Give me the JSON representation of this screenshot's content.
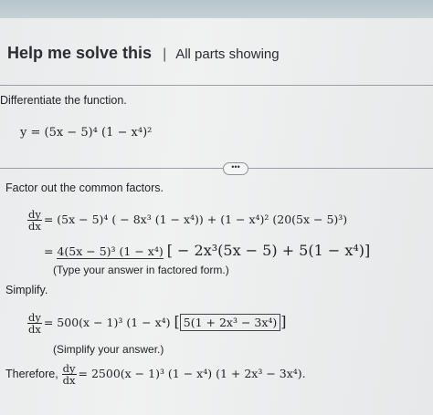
{
  "header": {
    "title": "Help me solve this",
    "separator": "|",
    "parts": "All parts showing"
  },
  "problem": {
    "instruction": "Differentiate the function.",
    "function": "y = (5x − 5)⁴ (1 − x⁴)²"
  },
  "expand_button": {
    "label": "•••"
  },
  "step1": {
    "instruction": "Factor out the common factors.",
    "dy": "dy",
    "dx": "dx",
    "line1": "= (5x − 5)⁴ ( − 8x³ (1 − x⁴)) + (1 − x⁴)² (20(5x − 5)³)",
    "line2_prefix": "=",
    "line2_factor": "4(5x − 5)³ (1 − x⁴)",
    "line2_bracket": "[ − 2x³(5x − 5) + 5(1 − x⁴)]",
    "hint": "(Type your answer in factored form.)"
  },
  "step2": {
    "label": "Simplify.",
    "dy": "dy",
    "dx": "dx",
    "lhs": "= 500(x − 1)³ (1 − x⁴)",
    "answer": "5(1 + 2x³ − 3x⁴)",
    "hint": "(Simplify your answer.)"
  },
  "conclusion": {
    "prefix": "Therefore,",
    "dy": "dy",
    "dx": "dx",
    "result": "= 2500(x − 1)³ (1 − x⁴) (1 + 2x³ − 3x⁴)."
  },
  "colors": {
    "background": "#ececed",
    "rule": "#9aa0a5"
  }
}
